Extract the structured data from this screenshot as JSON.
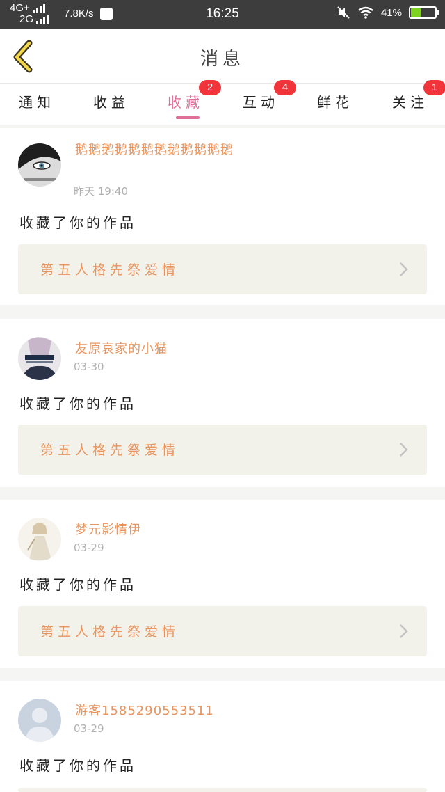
{
  "status_bar": {
    "net_top": "4G+",
    "net_bottom": "2G",
    "speed": "7.8K/s",
    "time": "16:25",
    "battery": "41%",
    "battery_level": 0.41
  },
  "header": {
    "title": "消息"
  },
  "tabs": [
    {
      "label": "通知",
      "badge": ""
    },
    {
      "label": "收益",
      "badge": ""
    },
    {
      "label": "收藏",
      "badge": "2",
      "active": true
    },
    {
      "label": "互动",
      "badge": "4"
    },
    {
      "label": "鲜花",
      "badge": ""
    },
    {
      "label": "关注",
      "badge": "1"
    }
  ],
  "messages": [
    {
      "username": "鹅鹅鹅鹅鹅鹅鹅鹅鹅鹅鹅鹅",
      "time": "昨天 19:40",
      "action": "收藏了你的作品",
      "work_title": "第五人格先祭爱情"
    },
    {
      "username": "友原哀家的小猫",
      "time": "03-30",
      "action": "收藏了你的作品",
      "work_title": "第五人格先祭爱情"
    },
    {
      "username": "梦元影情伊",
      "time": "03-29",
      "action": "收藏了你的作品",
      "work_title": "第五人格先祭爱情"
    },
    {
      "username": "游客1585290553511",
      "time": "03-29",
      "action": "收藏了你的作品",
      "work_title": ""
    }
  ],
  "colors": {
    "accent": "#e0709a",
    "username": "#e8945e",
    "badge": "#f0343a",
    "work_bg": "#f3f2ea"
  }
}
